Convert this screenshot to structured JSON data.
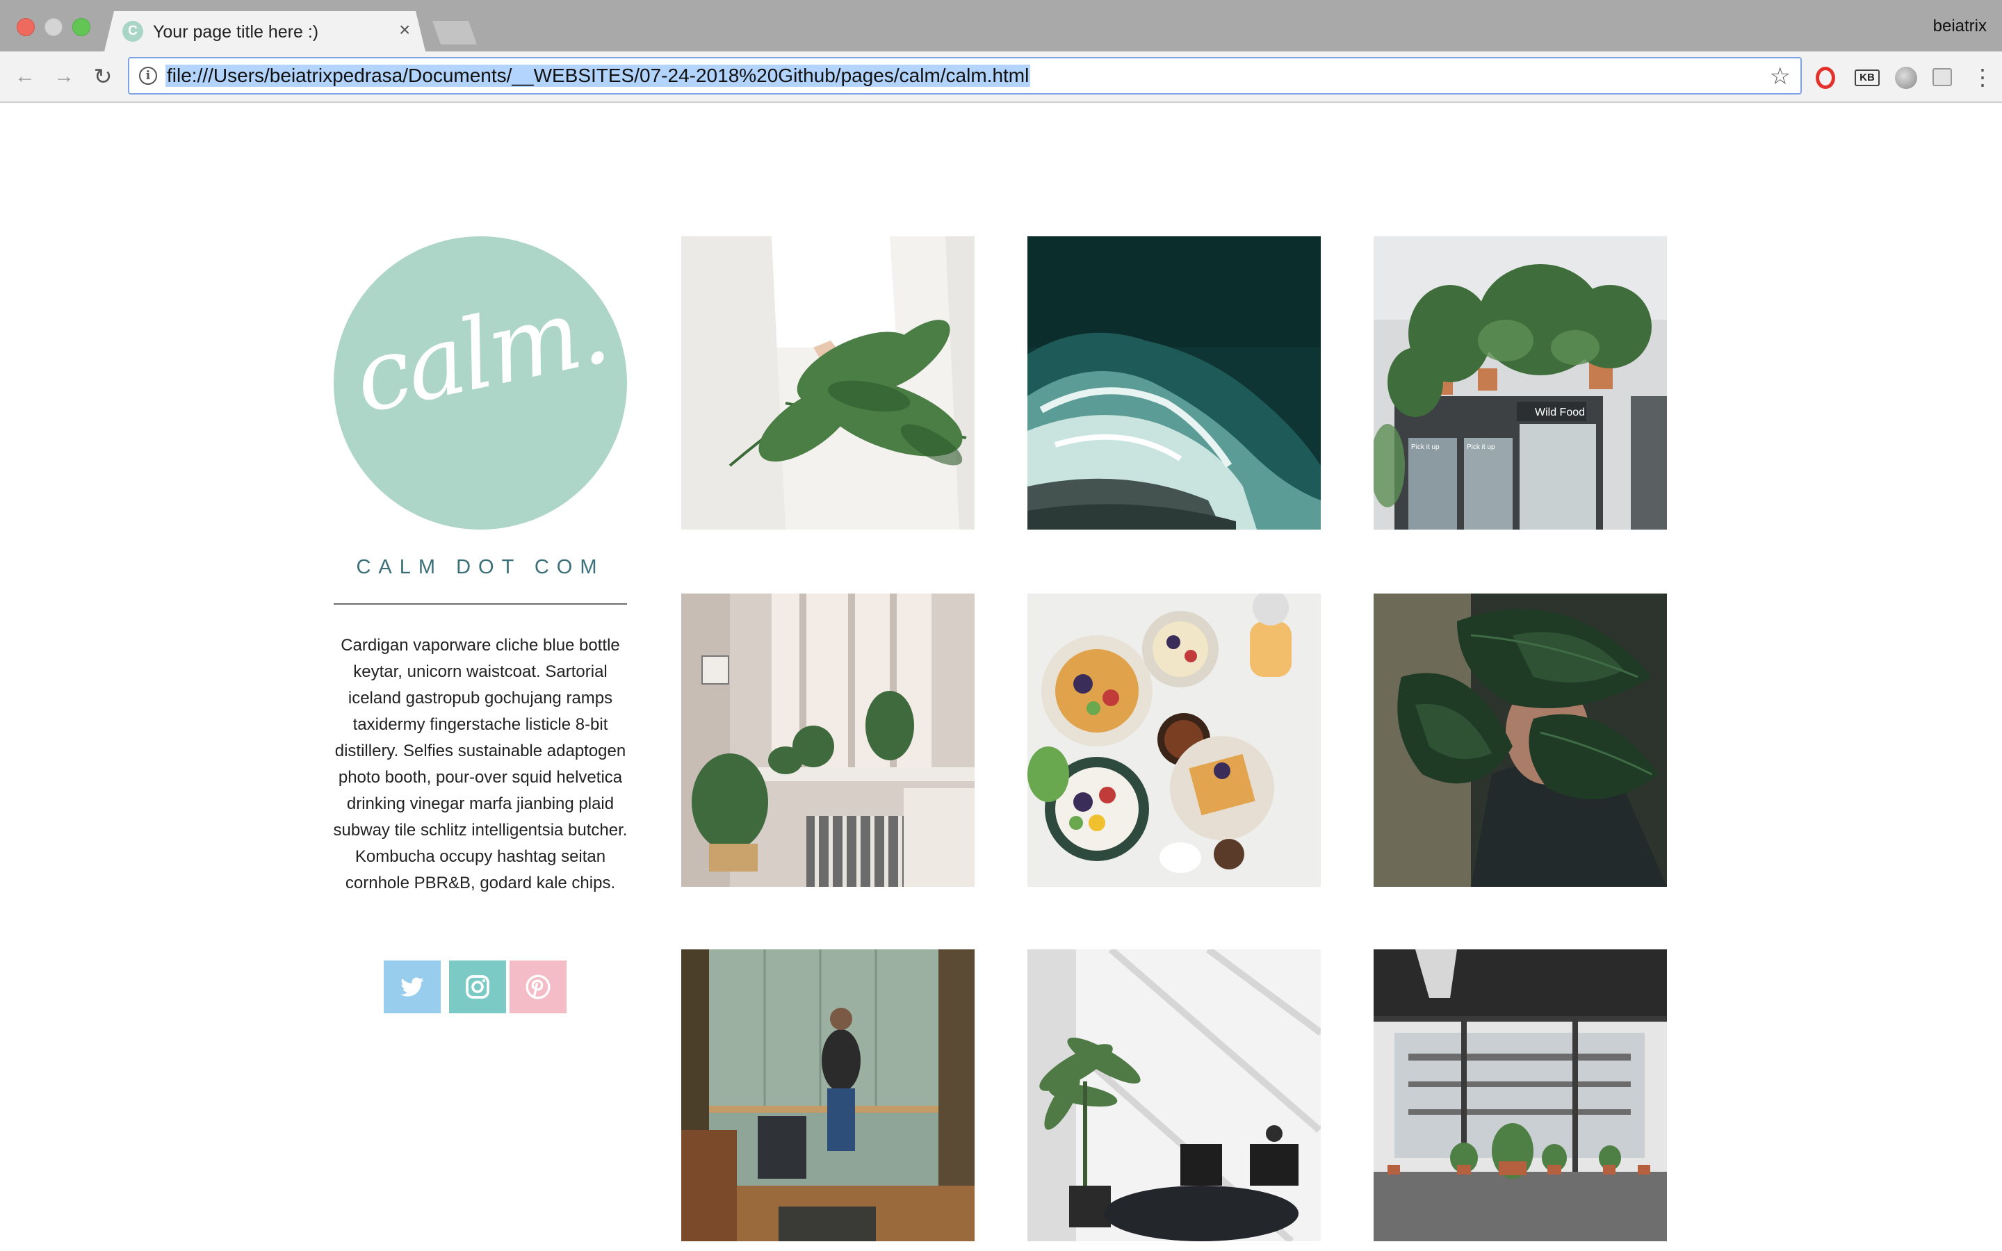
{
  "browser": {
    "tab_title": "Your page title here :)",
    "tab_favicon_letter": "C",
    "profile_name": "beiatrix",
    "url": "file:///Users/beiatrixpedrasa/Documents/__WEBSITES/07-24-2018%20Github/pages/calm/calm.html",
    "tab_close_glyph": "×",
    "extensions": [
      "opera-icon",
      "kb-icon",
      "circle-extension-icon",
      "square-extension-icon"
    ],
    "ext_kb_label": "KB"
  },
  "page": {
    "logo_text": "calm.",
    "brand_name": "CALM DOT COM",
    "bio": "Cardigan vaporware cliche blue bottle keytar, unicorn waistcoat. Sartorial iceland gastropub gochujang ramps taxidermy fingerstache listicle 8-bit distillery. Selfies sustainable adaptogen photo booth, pour-over squid helvetica drinking vinegar marfa jianbing plaid subway tile schlitz intelligentsia butcher. Kombucha occupy hashtag seitan cornhole PBR&B, godard kale chips.",
    "social": [
      "twitter-icon",
      "instagram-icon",
      "pinterest-icon"
    ],
    "photos": [
      "person holding fern",
      "ocean waves aerial",
      "plants above fridges",
      "window with plants",
      "breakfast bowls",
      "face behind monstera leaf",
      "man in green kitchen",
      "palm by large window",
      "plants on windowsill"
    ],
    "fridge_sign": "Wild Food",
    "fridge_label": "Pick it up",
    "colors": {
      "logo_circle": "#add6c8",
      "brand_text": "#3b6f78",
      "twitter": "#98cdee",
      "instagram": "#7ccac6",
      "pinterest": "#f4bcc6"
    }
  }
}
